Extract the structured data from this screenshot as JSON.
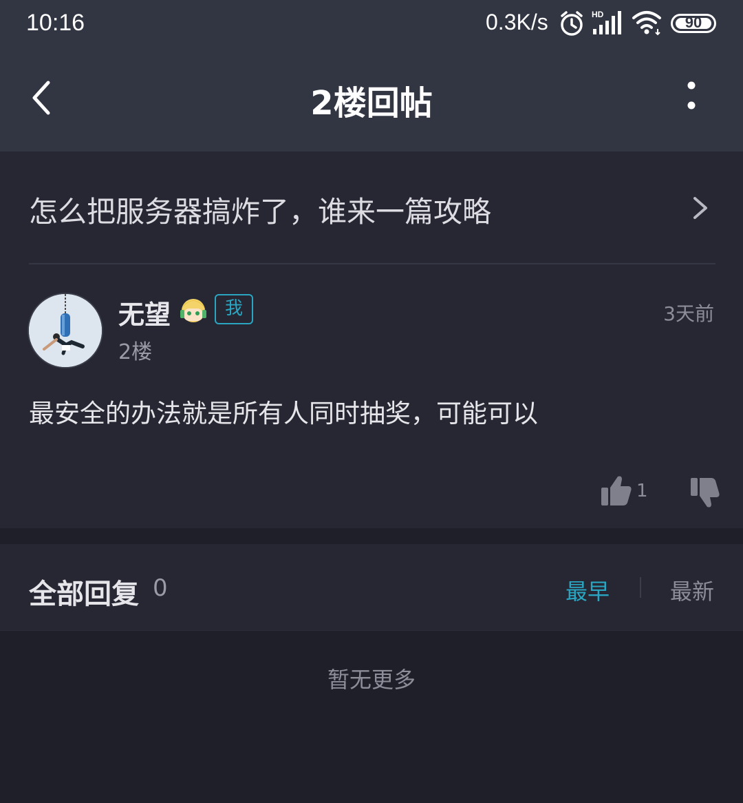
{
  "status_bar": {
    "time": "10:16",
    "network_speed": "0.3K/s",
    "network_type": "HD",
    "battery": "90",
    "icons": [
      "alarm-icon",
      "signal-icon",
      "wifi-icon",
      "battery-icon"
    ]
  },
  "nav": {
    "title": "2楼回帖",
    "back_icon": "chevron-left-icon",
    "more_icon": "more-vertical-icon"
  },
  "post": {
    "thread_title": "怎么把服务器搞炸了，谁来一篇攻略",
    "author": {
      "name": "无望",
      "me_badge": "我",
      "floor": "2楼"
    },
    "time_ago": "3天前",
    "content": "最安全的办法就是所有人同时抽奖，可能可以",
    "like_count": "1"
  },
  "replies": {
    "title": "全部回复",
    "count": "0",
    "sort_options": [
      "最早",
      "最新"
    ],
    "selected_sort": "最早",
    "empty_text": "暂无更多"
  },
  "colors": {
    "accent": "#2aa6c2",
    "header_bg": "#323542",
    "card_bg": "#262733",
    "page_bg": "#1e1f29"
  }
}
